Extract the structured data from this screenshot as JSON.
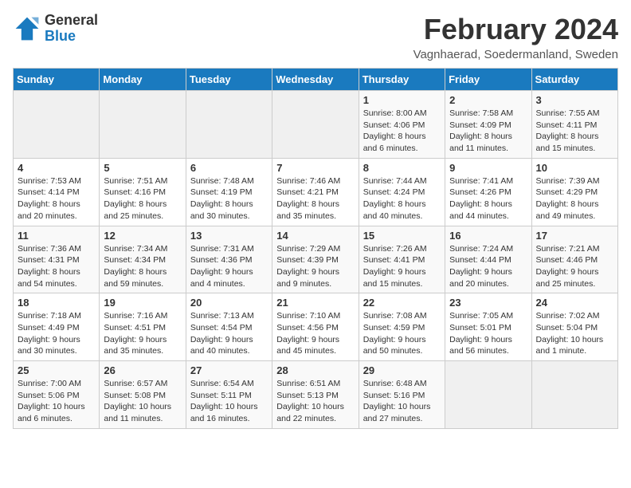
{
  "app": {
    "name": "GeneralBlue",
    "name_line1": "General",
    "name_line2": "Blue"
  },
  "header": {
    "month_year": "February 2024",
    "location": "Vagnhaerad, Soedermanland, Sweden"
  },
  "weekdays": [
    "Sunday",
    "Monday",
    "Tuesday",
    "Wednesday",
    "Thursday",
    "Friday",
    "Saturday"
  ],
  "weeks": [
    [
      {
        "day": "",
        "info": ""
      },
      {
        "day": "",
        "info": ""
      },
      {
        "day": "",
        "info": ""
      },
      {
        "day": "",
        "info": ""
      },
      {
        "day": "1",
        "info": "Sunrise: 8:00 AM\nSunset: 4:06 PM\nDaylight: 8 hours\nand 6 minutes."
      },
      {
        "day": "2",
        "info": "Sunrise: 7:58 AM\nSunset: 4:09 PM\nDaylight: 8 hours\nand 11 minutes."
      },
      {
        "day": "3",
        "info": "Sunrise: 7:55 AM\nSunset: 4:11 PM\nDaylight: 8 hours\nand 15 minutes."
      }
    ],
    [
      {
        "day": "4",
        "info": "Sunrise: 7:53 AM\nSunset: 4:14 PM\nDaylight: 8 hours\nand 20 minutes."
      },
      {
        "day": "5",
        "info": "Sunrise: 7:51 AM\nSunset: 4:16 PM\nDaylight: 8 hours\nand 25 minutes."
      },
      {
        "day": "6",
        "info": "Sunrise: 7:48 AM\nSunset: 4:19 PM\nDaylight: 8 hours\nand 30 minutes."
      },
      {
        "day": "7",
        "info": "Sunrise: 7:46 AM\nSunset: 4:21 PM\nDaylight: 8 hours\nand 35 minutes."
      },
      {
        "day": "8",
        "info": "Sunrise: 7:44 AM\nSunset: 4:24 PM\nDaylight: 8 hours\nand 40 minutes."
      },
      {
        "day": "9",
        "info": "Sunrise: 7:41 AM\nSunset: 4:26 PM\nDaylight: 8 hours\nand 44 minutes."
      },
      {
        "day": "10",
        "info": "Sunrise: 7:39 AM\nSunset: 4:29 PM\nDaylight: 8 hours\nand 49 minutes."
      }
    ],
    [
      {
        "day": "11",
        "info": "Sunrise: 7:36 AM\nSunset: 4:31 PM\nDaylight: 8 hours\nand 54 minutes."
      },
      {
        "day": "12",
        "info": "Sunrise: 7:34 AM\nSunset: 4:34 PM\nDaylight: 8 hours\nand 59 minutes."
      },
      {
        "day": "13",
        "info": "Sunrise: 7:31 AM\nSunset: 4:36 PM\nDaylight: 9 hours\nand 4 minutes."
      },
      {
        "day": "14",
        "info": "Sunrise: 7:29 AM\nSunset: 4:39 PM\nDaylight: 9 hours\nand 9 minutes."
      },
      {
        "day": "15",
        "info": "Sunrise: 7:26 AM\nSunset: 4:41 PM\nDaylight: 9 hours\nand 15 minutes."
      },
      {
        "day": "16",
        "info": "Sunrise: 7:24 AM\nSunset: 4:44 PM\nDaylight: 9 hours\nand 20 minutes."
      },
      {
        "day": "17",
        "info": "Sunrise: 7:21 AM\nSunset: 4:46 PM\nDaylight: 9 hours\nand 25 minutes."
      }
    ],
    [
      {
        "day": "18",
        "info": "Sunrise: 7:18 AM\nSunset: 4:49 PM\nDaylight: 9 hours\nand 30 minutes."
      },
      {
        "day": "19",
        "info": "Sunrise: 7:16 AM\nSunset: 4:51 PM\nDaylight: 9 hours\nand 35 minutes."
      },
      {
        "day": "20",
        "info": "Sunrise: 7:13 AM\nSunset: 4:54 PM\nDaylight: 9 hours\nand 40 minutes."
      },
      {
        "day": "21",
        "info": "Sunrise: 7:10 AM\nSunset: 4:56 PM\nDaylight: 9 hours\nand 45 minutes."
      },
      {
        "day": "22",
        "info": "Sunrise: 7:08 AM\nSunset: 4:59 PM\nDaylight: 9 hours\nand 50 minutes."
      },
      {
        "day": "23",
        "info": "Sunrise: 7:05 AM\nSunset: 5:01 PM\nDaylight: 9 hours\nand 56 minutes."
      },
      {
        "day": "24",
        "info": "Sunrise: 7:02 AM\nSunset: 5:04 PM\nDaylight: 10 hours\nand 1 minute."
      }
    ],
    [
      {
        "day": "25",
        "info": "Sunrise: 7:00 AM\nSunset: 5:06 PM\nDaylight: 10 hours\nand 6 minutes."
      },
      {
        "day": "26",
        "info": "Sunrise: 6:57 AM\nSunset: 5:08 PM\nDaylight: 10 hours\nand 11 minutes."
      },
      {
        "day": "27",
        "info": "Sunrise: 6:54 AM\nSunset: 5:11 PM\nDaylight: 10 hours\nand 16 minutes."
      },
      {
        "day": "28",
        "info": "Sunrise: 6:51 AM\nSunset: 5:13 PM\nDaylight: 10 hours\nand 22 minutes."
      },
      {
        "day": "29",
        "info": "Sunrise: 6:48 AM\nSunset: 5:16 PM\nDaylight: 10 hours\nand 27 minutes."
      },
      {
        "day": "",
        "info": ""
      },
      {
        "day": "",
        "info": ""
      }
    ]
  ]
}
